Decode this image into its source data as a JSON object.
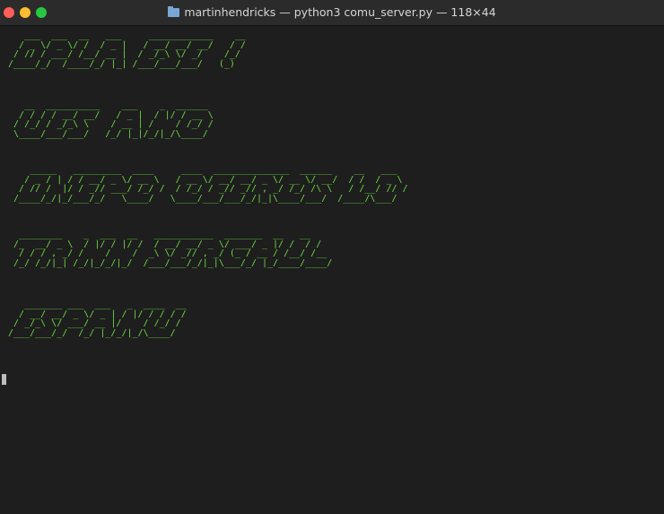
{
  "window": {
    "title": "martinhendricks — python3 comu_server.py — 118×44"
  },
  "terminal": {
    "banner_lines": [
      "    ___  ___  __   ___     ____________    __\n   / _ \\/ _ \\/ /  / _ |   / __/ __/ __/   / /\n  / // / ___/ /__/ __ |  / _/_\\ \\/ _/    /_/\n /____/_/  /____/_/ |_| /___/___/___/   (_)",
      "    __  __________    ___    _  ______ \n   / / / / __/ __/   / _ |  / |/ / __ \\\n  / /_/ / _/_\\ \\    / __ | /    / /_/ /\n  \\____/___/___/   /_/ |_|/_/|_/\\____/",
      "     _____   _________  ____     ____  ______________  ______    __   ___ \n    / _ / | / / __/ _ \\/ __ \\   / __ \\/ __/ __/ _ \\/ __ \\/ __/  / /  / _ \\\n   / // /  |/ / _// ___/ /_/ /  / /_/ / _// _// , _/ /_/ /\\ \\   / /__/ // /\n  /____/_/|_/___/_/   \\____/   \\____/___/___/_/|_|\\____/___/  /____/\\___/",
      "   ________    _  ___  __   ___________  _______  __   __ \n  /_  __/ _ \\  / |/ / |/ /  / __/ __/ _ \\/ ___/ _ |/ /  / /\n   / / / , _/ /    /    /  _\\ \\/ _// , _/ (_ / __ / /__/ /__\n  /_/ /_/|_| /_/|_/_/|_/  /___/___/_/|_|\\___/_/ |_/____/____/",
      "    _______ ___  ___   _  ____  __ \n   / __/ __/ _ \\/ _ | / |/ / / / /\n  / _/_\\ \\/ ___/ __ |/    / /_/ / \n /___/___/_/  /_/ |_/_/|_/\\____/"
    ]
  },
  "colors": {
    "background": "#1e1e1e",
    "text_green": "#6ddc44",
    "titlebar": "#2b2b2b"
  },
  "icons": {
    "title_icon": "folder-icon"
  }
}
